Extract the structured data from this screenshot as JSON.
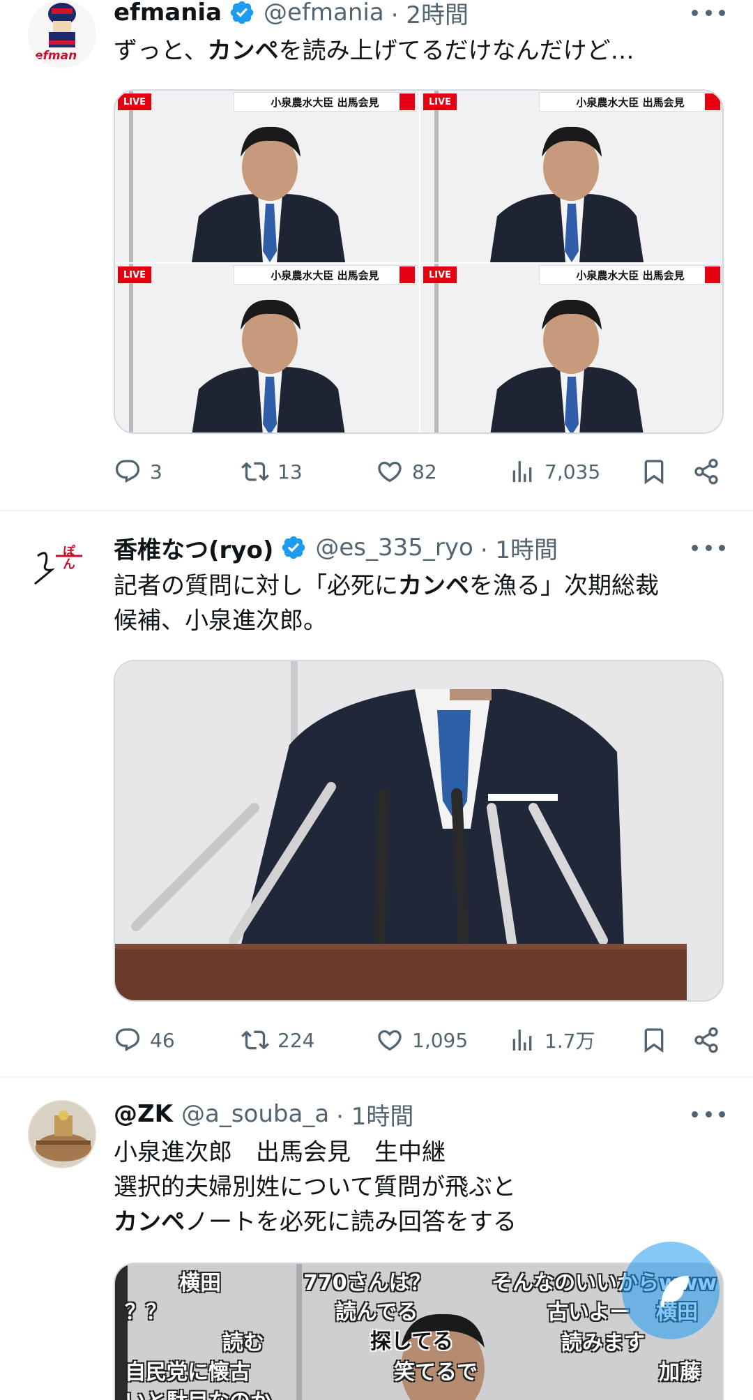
{
  "tweets": [
    {
      "name": "efmania",
      "handle": "@efmania",
      "time": "· 2時間",
      "avatar_text": "efman",
      "text_segments": [
        {
          "t": "ずっと、",
          "bold": false
        },
        {
          "t": "カンペ",
          "bold": true
        },
        {
          "t": "を読み上げてるだけなんだけど…",
          "bold": false
        }
      ],
      "media_frames": [
        {
          "live": "LIVE",
          "banner": "小泉農水大臣 出馬会見"
        },
        {
          "live": "LIVE",
          "banner": "小泉農水大臣 出馬会見"
        },
        {
          "live": "LIVE",
          "banner": "小泉農水大臣 出馬会見"
        },
        {
          "live": "LIVE",
          "banner": "小泉農水大臣 出馬会見"
        }
      ],
      "stats": {
        "replies": "3",
        "retweets": "13",
        "likes": "82",
        "views": "7,035"
      }
    },
    {
      "name": "香椎なつ(ryo)",
      "handle": "@es_335_ryo",
      "time": "· 1時間",
      "avatar_text": "ぽん",
      "text_segments": [
        {
          "t": "記者の質問に対し「必死に",
          "bold": false
        },
        {
          "t": "カンペ",
          "bold": true
        },
        {
          "t": "を漁る」次期総裁",
          "bold": false
        },
        {
          "t": "\n候補、小泉進次郎。",
          "bold": false
        }
      ],
      "stats": {
        "replies": "46",
        "retweets": "224",
        "likes": "1,095",
        "views": "1.7万"
      }
    },
    {
      "name": "@ZK",
      "handle": "@a_souba_a",
      "time": "· 1時間",
      "text_lines": [
        "小泉進次郎　出馬会見　生中継",
        "選択的夫婦別姓について質問が飛ぶと"
      ],
      "text_bold": "カンペ",
      "text_last_rest": "ノートを必死に読み回答をする",
      "overlay_comments": [
        "横田",
        "770さんは？",
        "そんなのいいからwww",
        "？？",
        "読んでる",
        "古いよー",
        "横田",
        "読む",
        "探してる",
        "読みます",
        "自民党に懐古",
        "笑てるで",
        "加藤",
        "いと駄目なのか"
      ]
    }
  ],
  "colors": {
    "text": "#0f1419",
    "secondary": "#536471",
    "verified": "#1d9bf0",
    "border": "#cfd9de"
  }
}
